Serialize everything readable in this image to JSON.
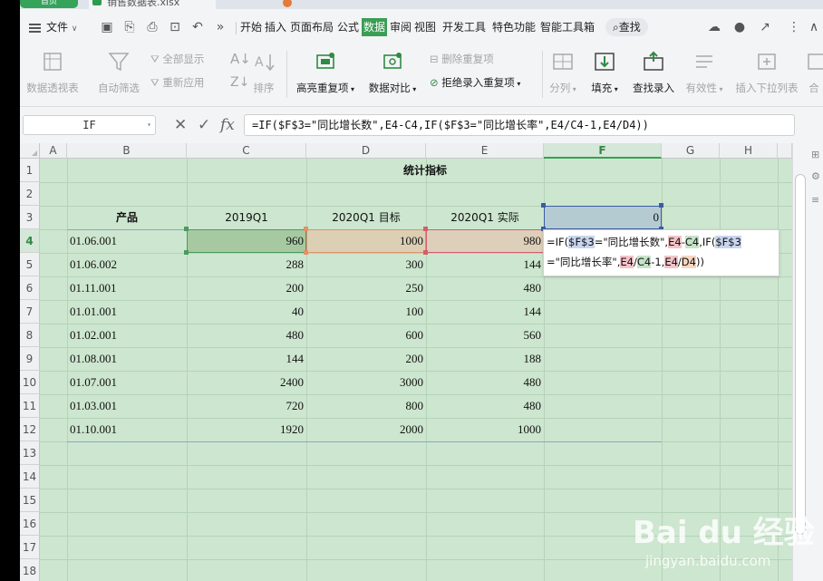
{
  "titlebar": {
    "tab_home": "首页",
    "tab_file": "销售数据表.xlsx"
  },
  "menubar": {
    "file_label": "文件",
    "items": [
      "开始",
      "插入",
      "页面布局",
      "公式",
      "数据",
      "审阅",
      "视图",
      "开发工具",
      "特色功能",
      "智能工具箱"
    ],
    "active_item": "数据",
    "search_label": "查找"
  },
  "ribbon": {
    "pivot": "数据透视表",
    "auto_filter": "自动筛选",
    "show_all": "全部显示",
    "reapply": "重新应用",
    "sort": "排序",
    "highlight_dup": "高亮重复项",
    "compare": "数据对比",
    "delete_dup": "删除重复项",
    "reject_dup": "拒绝录入重复项",
    "split": "分列",
    "fill": "填充",
    "find_entry": "查找录入",
    "validity": "有效性",
    "insert_dropdown": "插入下拉列表",
    "merge": "合"
  },
  "formulabar": {
    "name_box": "IF",
    "formula": "=IF($F$3=\"同比增长数\",E4-C4,IF($F$3=\"同比增长率\",E4/C4-1,E4/D4))"
  },
  "grid": {
    "columns": [
      "A",
      "B",
      "C",
      "D",
      "E",
      "F",
      "G",
      "H"
    ],
    "selected_column": "F",
    "rows": [
      "1",
      "2",
      "3",
      "4",
      "5",
      "6",
      "7",
      "8",
      "9",
      "10",
      "11",
      "12",
      "13",
      "14",
      "15",
      "16",
      "17",
      "18"
    ],
    "selected_row": "4",
    "section_title": "统计指标",
    "headers": {
      "product": "产品",
      "c": "2019Q1",
      "d": "2020Q1 目标",
      "e": "2020Q1 实际",
      "f": "0"
    },
    "data": [
      {
        "product": "01.06.001",
        "c": "960",
        "d": "1000",
        "e": "980"
      },
      {
        "product": "01.06.002",
        "c": "288",
        "d": "300",
        "e": "144"
      },
      {
        "product": "01.11.001",
        "c": "200",
        "d": "250",
        "e": "480"
      },
      {
        "product": "01.01.001",
        "c": "40",
        "d": "100",
        "e": "144"
      },
      {
        "product": "01.02.001",
        "c": "480",
        "d": "600",
        "e": "560"
      },
      {
        "product": "01.08.001",
        "c": "144",
        "d": "200",
        "e": "188"
      },
      {
        "product": "01.07.001",
        "c": "2400",
        "d": "3000",
        "e": "480"
      },
      {
        "product": "01.03.001",
        "c": "720",
        "d": "800",
        "e": "480"
      },
      {
        "product": "01.10.001",
        "c": "1920",
        "d": "2000",
        "e": "1000"
      }
    ]
  },
  "popup": {
    "p1": "=IF(",
    "f1": "$F$3",
    "p2": "=\"同比增长数\",",
    "e1": "E4",
    "p3": "-",
    "c1": "C4",
    "p4": ",IF(",
    "f2": "$F$3",
    "p5": "=\"同比增长率\",",
    "e2": "E4",
    "p6": "/",
    "c2": "C4",
    "p7": "-1,",
    "e3": "E4",
    "p8": "/",
    "d1": "D4",
    "p9": "))"
  },
  "watermark": {
    "logo": "Bai du 经验",
    "url": "jingyan.baidu.com"
  },
  "colors": {
    "accent": "#3a9e55",
    "grid_bg": "#cde6cf",
    "ref_c": "#4c9a5c",
    "ref_d": "#e0926a",
    "ref_e": "#d35e6e",
    "ref_f": "#3b5ca5"
  }
}
